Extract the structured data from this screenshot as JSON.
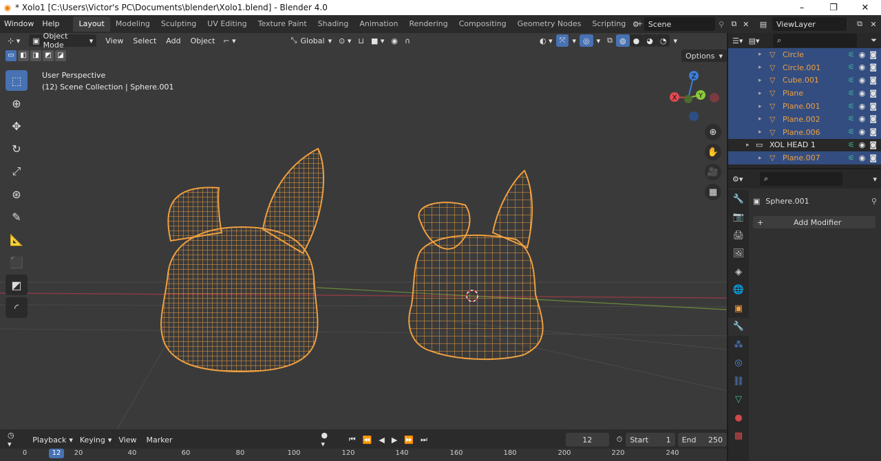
{
  "window": {
    "title": "* Xolo1 [C:\\Users\\Victor's PC\\Documents\\blender\\Xolo1.blend] - Blender 4.0",
    "minimize": "–",
    "restore": "❐",
    "close": "✕"
  },
  "menu": {
    "items": [
      "Window",
      "Help"
    ],
    "workspace_tabs": [
      "Layout",
      "Modeling",
      "Sculpting",
      "UV Editing",
      "Texture Paint",
      "Shading",
      "Animation",
      "Rendering",
      "Compositing",
      "Geometry Nodes",
      "Scripting"
    ],
    "active_tab": "Layout",
    "add_tab": "+",
    "scene": "Scene",
    "view_layer": "ViewLayer"
  },
  "viewport": {
    "mode": "Object Mode",
    "menus": [
      "View",
      "Select",
      "Add",
      "Object"
    ],
    "transform_orientation": "Global",
    "options": "Options",
    "perspective_label": "User Perspective",
    "collection_label": "(12) Scene Collection | Sphere.001",
    "gizmo": {
      "x": "X",
      "y": "Y",
      "z": "Z"
    }
  },
  "outliner": {
    "rows": [
      {
        "name": "Circle",
        "color": "orange",
        "selected": true
      },
      {
        "name": "Circle.001",
        "color": "orange",
        "selected": true
      },
      {
        "name": "Cube.001",
        "color": "orange",
        "selected": true
      },
      {
        "name": "Plane",
        "color": "orange",
        "selected": true
      },
      {
        "name": "Plane.001",
        "color": "orange",
        "selected": true
      },
      {
        "name": "Plane.002",
        "color": "orange",
        "selected": true
      },
      {
        "name": "Plane.006",
        "color": "orange",
        "selected": true
      },
      {
        "name": "XOL HEAD 1",
        "color": "white",
        "selected": false
      },
      {
        "name": "Plane.007",
        "color": "orange",
        "selected": true
      }
    ]
  },
  "properties": {
    "object_name": "Sphere.001",
    "add_modifier": "Add Modifier"
  },
  "timeline": {
    "menus": [
      "Playback",
      "Keying",
      "View",
      "Marker"
    ],
    "current_frame": "12",
    "start_label": "Start",
    "start_value": "1",
    "end_label": "End",
    "end_value": "250",
    "ruler": [
      "0",
      "20",
      "40",
      "60",
      "80",
      "100",
      "120",
      "140",
      "160",
      "180",
      "200",
      "220",
      "240"
    ]
  },
  "colors": {
    "accent": "#4772b3",
    "wire_selected": "#f0a040",
    "viewport_bg": "#3a3a3a"
  }
}
